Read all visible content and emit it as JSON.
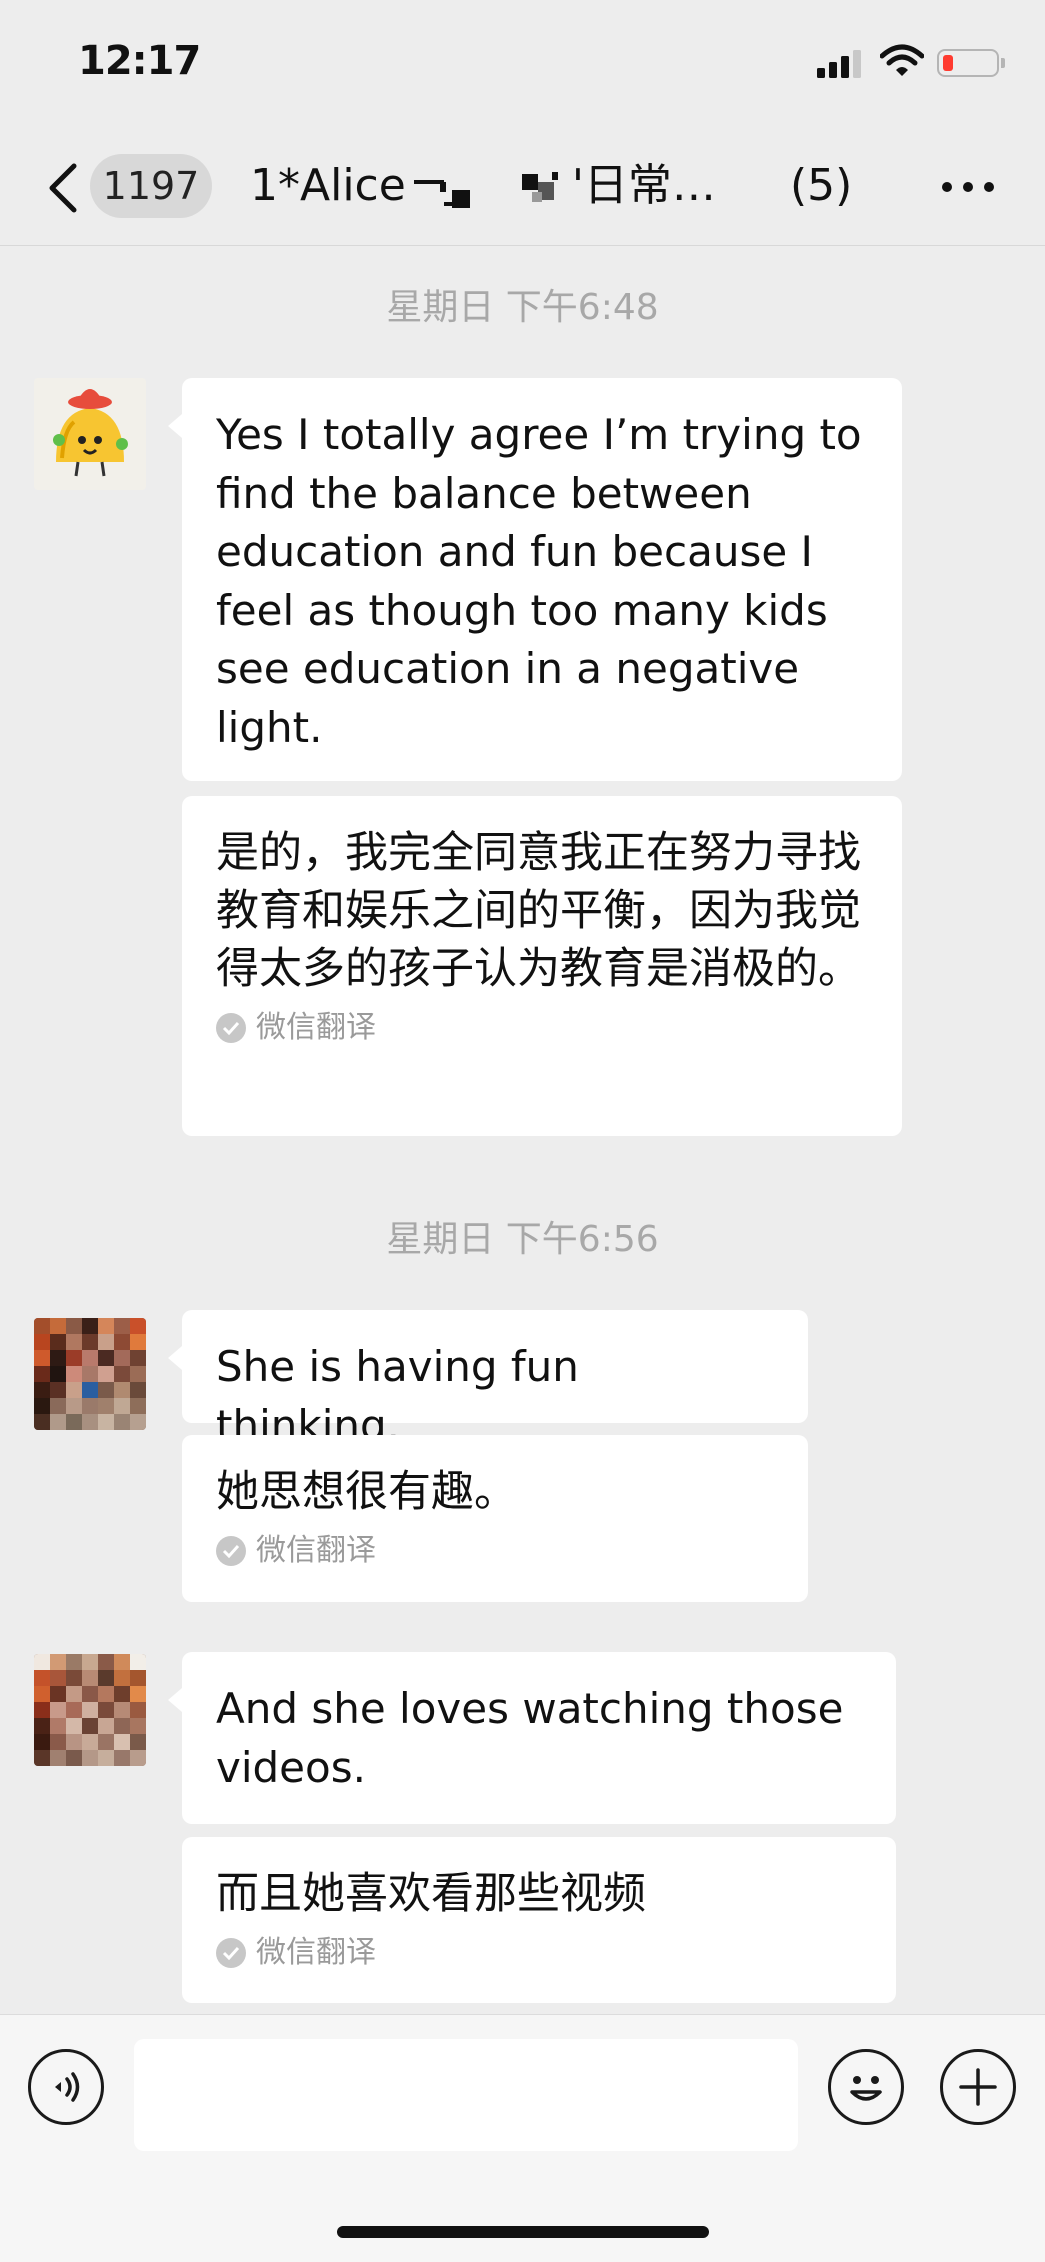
{
  "status_bar": {
    "time": "12:17"
  },
  "nav": {
    "unread_count": "1197",
    "title_prefix": "1*Alice",
    "title_suffix": "'日常…",
    "member_count": "(5)"
  },
  "messages": [
    {
      "timestamp": "星期日 下午6:48",
      "text": "Yes I totally agree I’m trying to find the balance between education and fun because I feel as though too many kids see education in a negative light.",
      "translation": "是的，我完全同意我正在努力寻找教育和娱乐之间的平衡，因为我觉得太多的孩子认为教育是消极的。",
      "translation_label": "微信翻译"
    },
    {
      "timestamp": "星期日 下午6:56",
      "text": "She is having fun thinking.",
      "translation": "她思想很有趣。",
      "translation_label": "微信翻译"
    },
    {
      "text": "And she loves watching those videos.",
      "translation": "而且她喜欢看那些视频",
      "translation_label": "微信翻译"
    }
  ],
  "colors": {
    "background": "#ededed",
    "bubble": "#ffffff",
    "battery_low": "#ff3b30",
    "muted_text": "#a8a8a8"
  }
}
